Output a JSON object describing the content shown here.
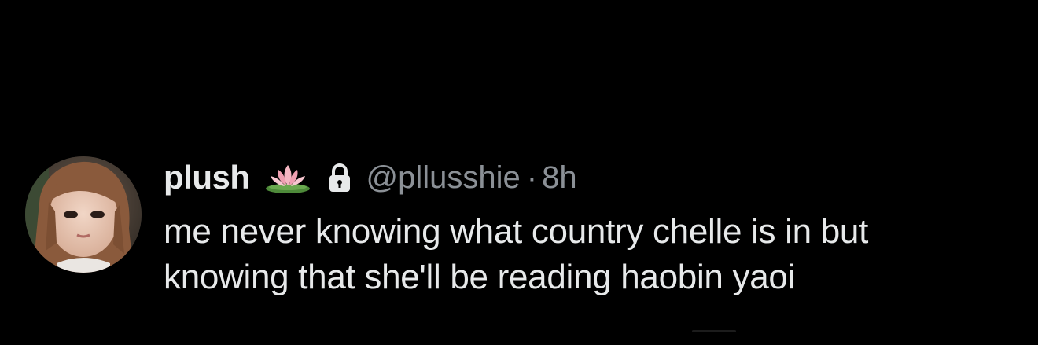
{
  "tweet": {
    "display_name": "plush",
    "name_emoji": "lotus-emoji",
    "protected_icon": "lock-icon",
    "handle": "@pllusshie",
    "separator": "·",
    "time": "8h",
    "text_lines": [
      "me never knowing what country chelle is in but",
      "knowing that she'll be reading haobin yaoi"
    ]
  },
  "colors": {
    "background": "#000000",
    "primary_text": "#e7e9ea",
    "secondary_text": "#8b9096"
  }
}
